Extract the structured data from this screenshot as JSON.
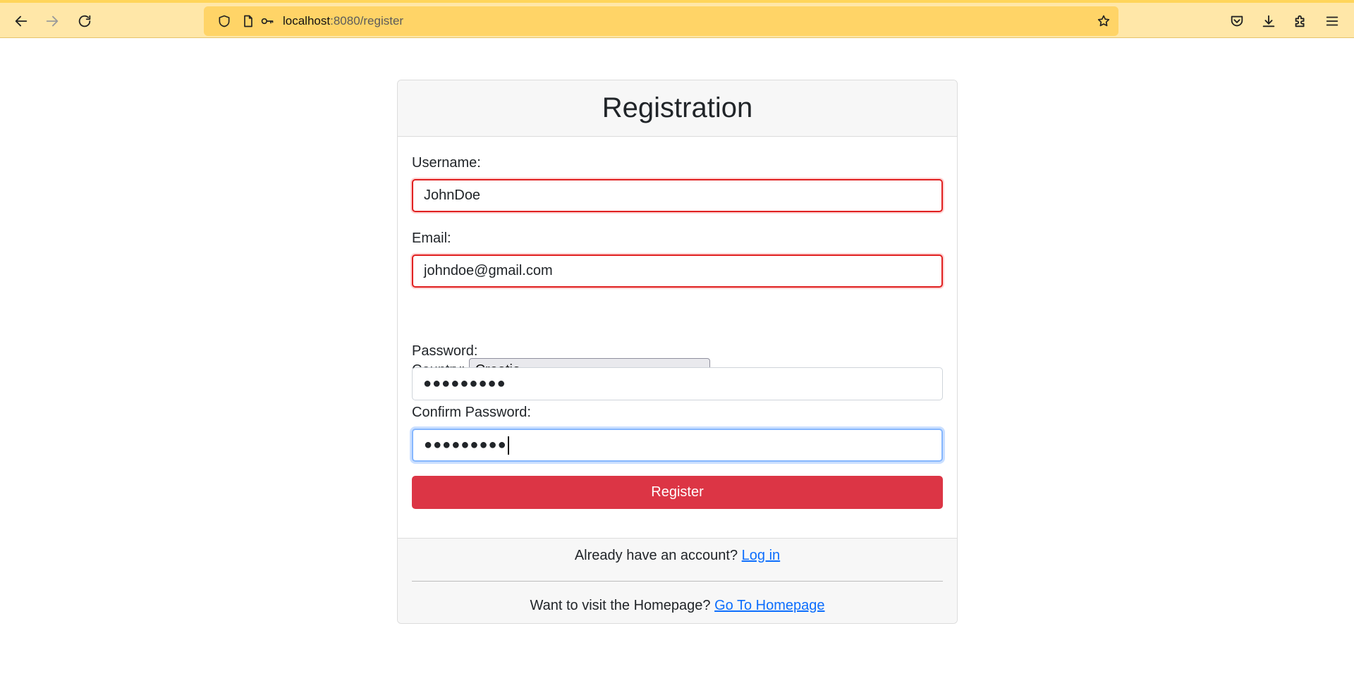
{
  "browser": {
    "url_host": "localhost",
    "url_path": ":8080/register",
    "accent_color": "#ffe7a8"
  },
  "form": {
    "title": "Registration",
    "username": {
      "label": "Username:",
      "value": "JohnDoe"
    },
    "email": {
      "label": "Email:",
      "value": "johndoe@gmail.com"
    },
    "country": {
      "label": "Country:",
      "selected": "Croatia"
    },
    "password": {
      "label": "Password:",
      "masked_value": "●●●●●●●●●"
    },
    "confirm_password": {
      "label": "Confirm Password:",
      "masked_value": "●●●●●●●●●"
    },
    "submit_label": "Register",
    "submit_color": "#dc3545"
  },
  "footer": {
    "login_prompt": "Already have an account?",
    "login_link": "Log in",
    "home_prompt": "Want to visit the Homepage?",
    "home_link": "Go To Homepage"
  }
}
